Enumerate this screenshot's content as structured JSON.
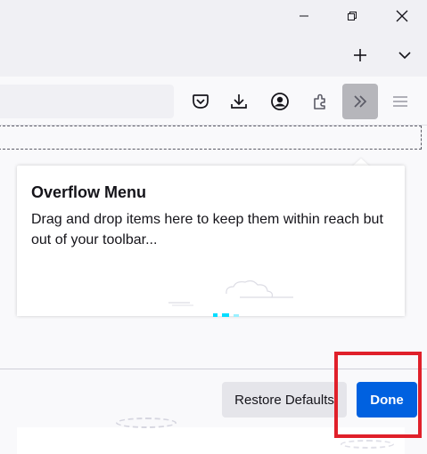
{
  "window": {
    "minimize_icon": "minimize-icon",
    "restore_icon": "restore-icon",
    "close_icon": "close-icon"
  },
  "tabs": {
    "new_tab_icon": "plus-icon",
    "list_all_tabs_icon": "chevron-down-icon"
  },
  "toolbar": {
    "icons": [
      "pocket-icon",
      "download-icon",
      "account-icon",
      "extensions-icon",
      "overflow-chevrons-icon",
      "hamburger-menu-icon"
    ]
  },
  "overflow_panel": {
    "title": "Overflow Menu",
    "description": "Drag and drop items here to keep them within reach but out of your toolbar..."
  },
  "footer": {
    "restore_label": "Restore Defaults",
    "done_label": "Done"
  },
  "colors": {
    "accent": "#0061e0",
    "highlight": "#e0202a",
    "active_button": "#b6b6bb"
  }
}
